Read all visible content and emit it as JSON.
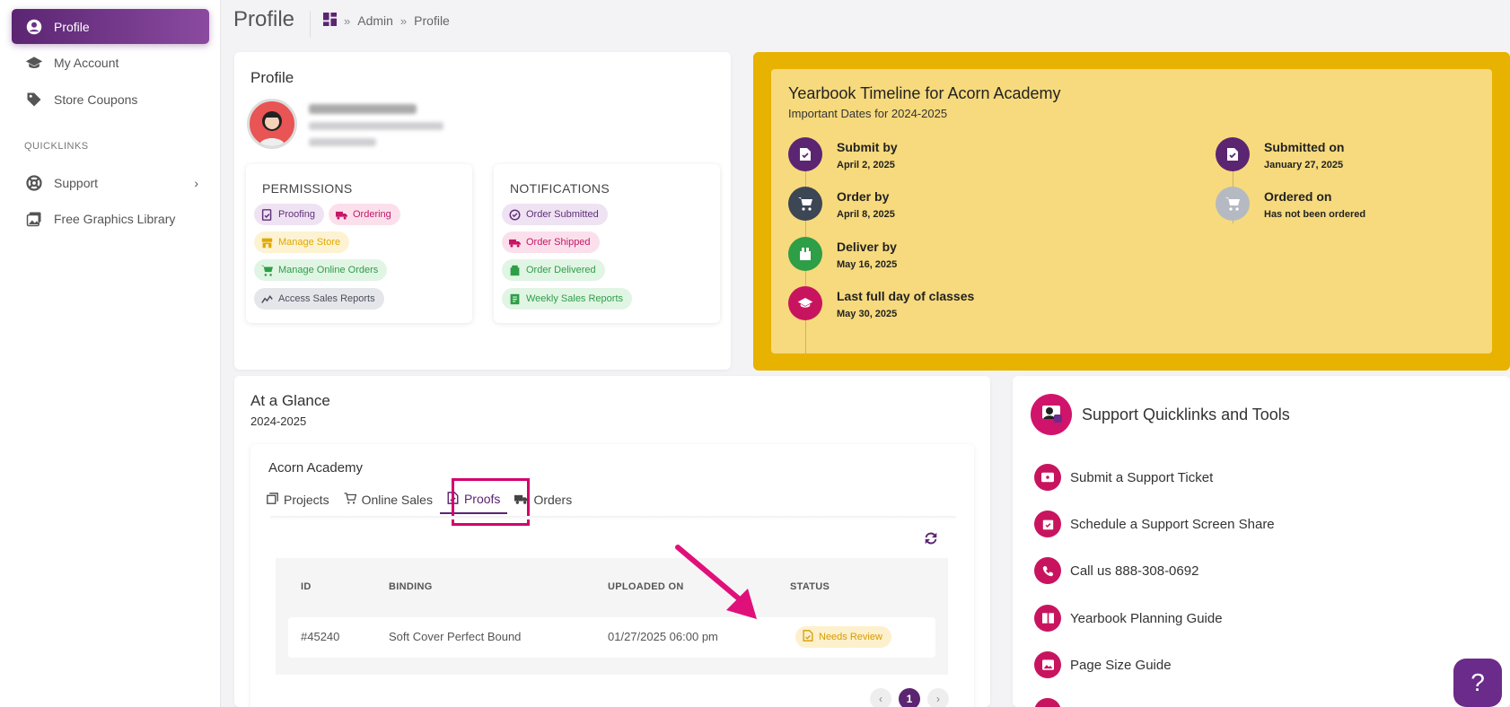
{
  "sidebar": {
    "items": [
      {
        "label": "Profile",
        "icon": "user-circle-icon"
      },
      {
        "label": "My Account",
        "icon": "graduation-cap-icon"
      },
      {
        "label": "Store Coupons",
        "icon": "tag-icon"
      }
    ],
    "section_label": "QUICKLINKS",
    "quicklinks": [
      {
        "label": "Support",
        "icon": "lifebuoy-icon"
      },
      {
        "label": "Free Graphics Library",
        "icon": "images-icon"
      }
    ]
  },
  "header": {
    "title": "Profile",
    "breadcrumb": [
      "Admin",
      "Profile"
    ],
    "separator": "»"
  },
  "profile": {
    "title": "Profile",
    "permissions": {
      "title": "PERMISSIONS",
      "chips": [
        "Proofing",
        "Ordering",
        "Manage Store",
        "Manage Online Orders",
        "Access Sales Reports"
      ]
    },
    "notifications": {
      "title": "NOTIFICATIONS",
      "chips": [
        "Order Submitted",
        "Order Shipped",
        "Order Delivered",
        "Weekly Sales Reports"
      ]
    }
  },
  "timeline": {
    "title": "Yearbook Timeline for Acorn Academy",
    "subtitle": "Important Dates for 2024-2025",
    "left": [
      {
        "label": "Submit by",
        "date": "April 2, 2025",
        "color": "#5b2572"
      },
      {
        "label": "Order by",
        "date": "April 8, 2025",
        "color": "#3c4654"
      },
      {
        "label": "Deliver by",
        "date": "May 16, 2025",
        "color": "#2e9e47"
      },
      {
        "label": "Last full day of classes",
        "date": "May 30, 2025",
        "color": "#c8145f"
      }
    ],
    "right": [
      {
        "label": "Submitted on",
        "date": "January 27, 2025",
        "color": "#5b2572"
      },
      {
        "label": "Ordered on",
        "date": "Has not been ordered",
        "color": "#b5b9c2"
      }
    ]
  },
  "glance": {
    "title": "At a Glance",
    "year": "2024-2025",
    "school": "Acorn Academy",
    "tabs": [
      "Projects",
      "Online Sales",
      "Proofs",
      "Orders"
    ],
    "active_tab": "Proofs",
    "columns": [
      "ID",
      "BINDING",
      "UPLOADED ON",
      "STATUS"
    ],
    "rows": [
      {
        "id": "#45240",
        "binding": "Soft Cover Perfect Bound",
        "uploaded": "01/27/2025 06:00 pm",
        "status": "Needs Review"
      }
    ],
    "pager": {
      "prev": "‹",
      "current": "1",
      "next": "›"
    }
  },
  "support": {
    "title": "Support Quicklinks and Tools",
    "links": [
      "Submit a Support Ticket",
      "Schedule a Support Screen Share",
      "Call us 888-308-0692",
      "Yearbook Planning Guide",
      "Page Size Guide"
    ]
  },
  "help_button": "?",
  "colors": {
    "brand": "#5b2572",
    "accent_pink": "#c8145f",
    "timeline_bg": "#f7da7d",
    "timeline_border": "#e8b200"
  }
}
